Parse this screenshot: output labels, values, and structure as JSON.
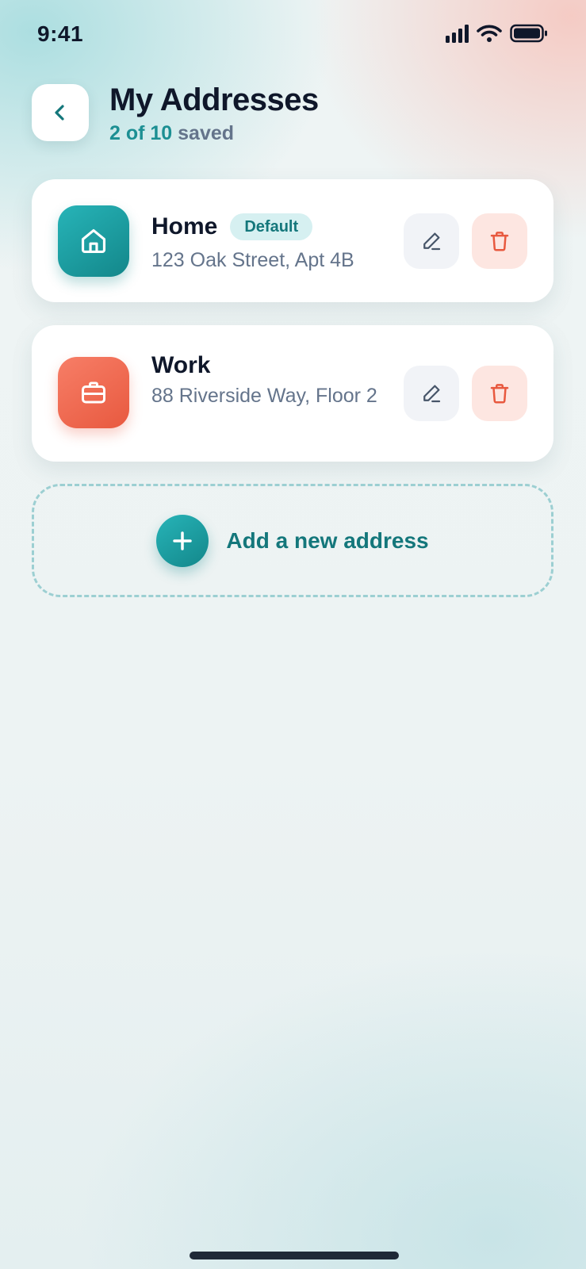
{
  "status_bar": {
    "time": "9:41"
  },
  "header": {
    "title": "My Addresses",
    "saved_count": "2 of 10",
    "saved_suffix": "saved"
  },
  "addresses": [
    {
      "label": "Home",
      "badge": "Default",
      "address": "123 Oak Street, Apt 4B",
      "icon": "home-icon",
      "color": "#1c9a9e"
    },
    {
      "label": "Work",
      "badge": "",
      "address": "88 Riverside Way, Floor 2",
      "icon": "briefcase-icon",
      "color": "#f06a51"
    }
  ],
  "add_address": {
    "label": "Add a new address",
    "icon": "plus-icon"
  },
  "colors": {
    "accent": "#14777b",
    "danger": "#e8593f",
    "text": "#0f172a",
    "muted": "#64748b"
  }
}
